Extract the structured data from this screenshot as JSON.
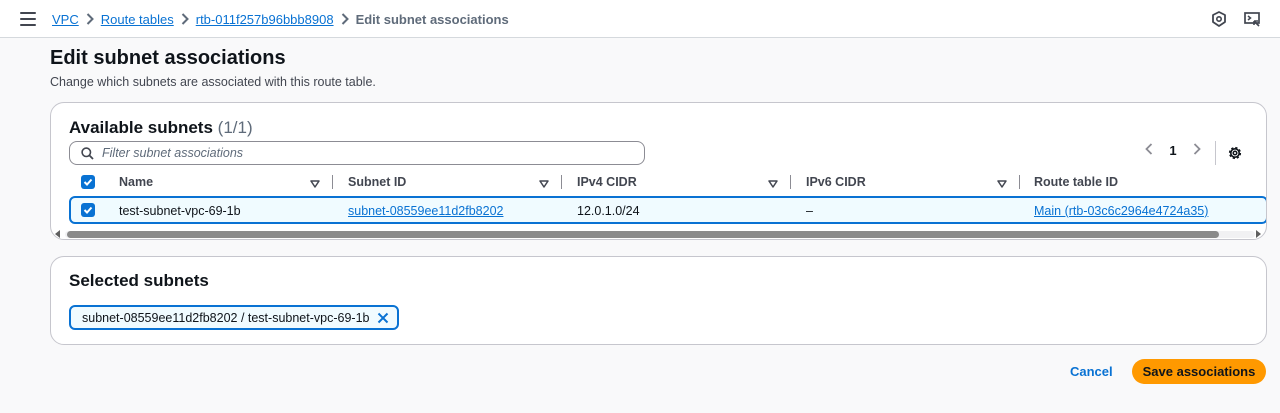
{
  "breadcrumb": {
    "items": [
      "VPC",
      "Route tables",
      "rtb-011f257b96bbb8908"
    ],
    "current": "Edit subnet associations"
  },
  "header": {
    "icons": [
      "security-shield-icon",
      "cloudshell-icon"
    ]
  },
  "page": {
    "title": "Edit subnet associations",
    "description": "Change which subnets are associated with this route table."
  },
  "available": {
    "title": "Available subnets",
    "count": "(1/1)",
    "filter_placeholder": "Filter subnet associations",
    "page_number": "1",
    "columns": [
      "Name",
      "Subnet ID",
      "IPv4 CIDR",
      "IPv6 CIDR",
      "Route table ID"
    ],
    "rows": [
      {
        "name": "test-subnet-vpc-69-1b",
        "subnet_id": "subnet-08559ee11d2fb8202",
        "ipv4": "12.0.1.0/24",
        "ipv6": "–",
        "route_table": "Main (rtb-03c6c2964e4724a35)",
        "selected": true
      }
    ]
  },
  "selected": {
    "title": "Selected subnets",
    "tokens": [
      "subnet-08559ee11d2fb8202 / test-subnet-vpc-69-1b"
    ]
  },
  "actions": {
    "cancel": "Cancel",
    "save": "Save associations"
  },
  "colors": {
    "link": "#0972d3",
    "primary_button": "#ff9900",
    "selected_row_bg": "#f0fbff"
  }
}
